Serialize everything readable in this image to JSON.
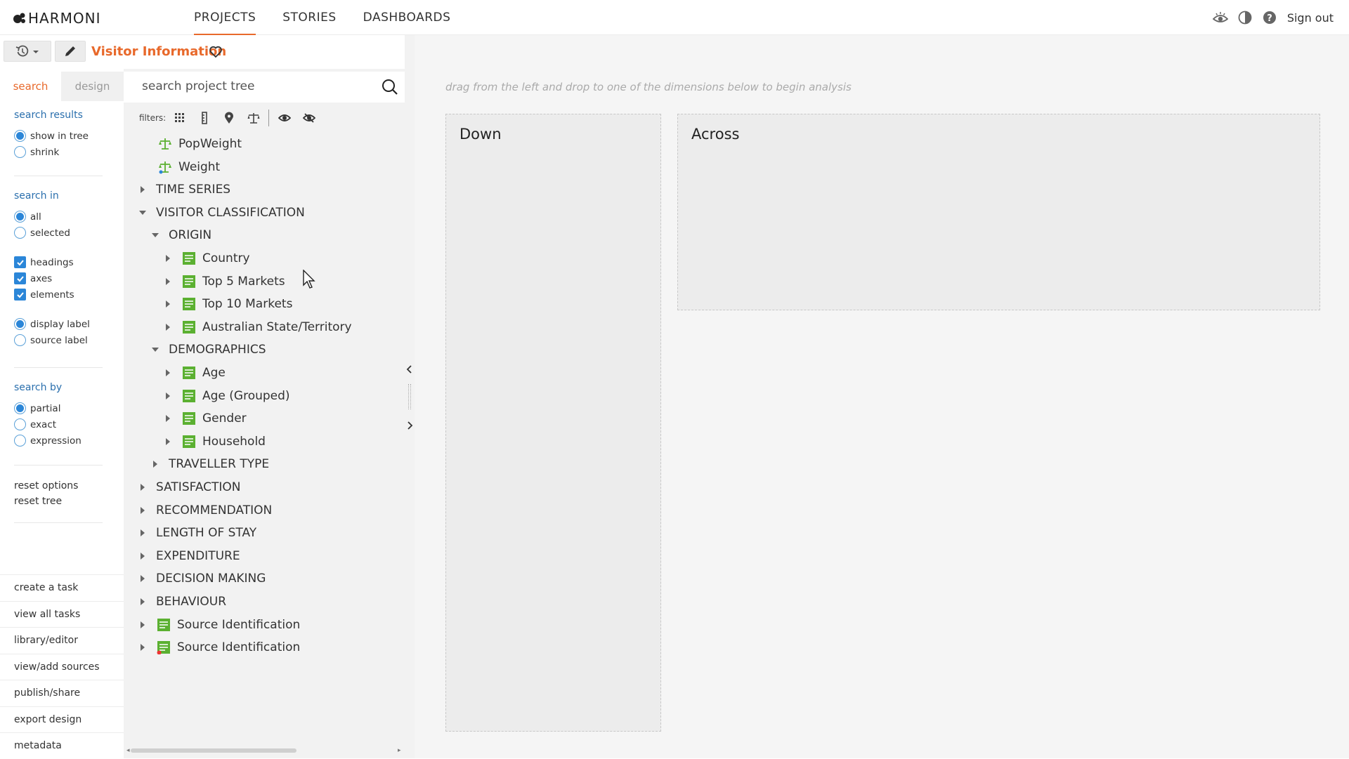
{
  "brand": {
    "name": "HARMONI"
  },
  "nav": {
    "items": [
      "PROJECTS",
      "STORIES",
      "DASHBOARDS"
    ],
    "active": "PROJECTS"
  },
  "top_right": {
    "icons": [
      "eye-icon",
      "contrast-icon",
      "help-icon"
    ],
    "sign_out": "Sign out"
  },
  "toolbar": {
    "title": "Visitor Information",
    "history_icon": "history-icon",
    "edit_icon": "pencil-icon",
    "favorite_icon": "heart-icon"
  },
  "left_tabs": {
    "search": "search",
    "design": "design"
  },
  "search_results": {
    "title": "search results",
    "options": [
      "show in tree",
      "shrink"
    ],
    "selected": "show in tree"
  },
  "search_in": {
    "title": "search in",
    "options": [
      "all",
      "selected"
    ],
    "selected": "all",
    "checks": [
      "headings",
      "axes",
      "elements"
    ],
    "label_options": [
      "display label",
      "source label"
    ],
    "label_selected": "display label"
  },
  "search_by": {
    "title": "search by",
    "options": [
      "partial",
      "exact",
      "expression"
    ],
    "selected": "partial"
  },
  "resets": [
    "reset options",
    "reset tree"
  ],
  "bottom_links": [
    "create a task",
    "view all tasks",
    "library/editor",
    "view/add sources",
    "publish/share",
    "export design",
    "metadata"
  ],
  "tree_search": {
    "placeholder": "search project tree"
  },
  "filters": {
    "label": "filters:"
  },
  "tree": [
    {
      "label": "PopWeight",
      "depth": 1,
      "type": "weight",
      "arrow": "none"
    },
    {
      "label": "Weight",
      "depth": 1,
      "type": "weight2",
      "arrow": "none"
    },
    {
      "label": "TIME SERIES",
      "depth": 0,
      "type": "folder",
      "arrow": "right"
    },
    {
      "label": "VISITOR CLASSIFICATION",
      "depth": 0,
      "type": "folder",
      "arrow": "down"
    },
    {
      "label": "ORIGIN",
      "depth": 1,
      "type": "folder",
      "arrow": "down"
    },
    {
      "label": "Country",
      "depth": 2,
      "type": "var",
      "arrow": "right"
    },
    {
      "label": "Top 5 Markets",
      "depth": 2,
      "type": "var",
      "arrow": "right"
    },
    {
      "label": "Top 10 Markets",
      "depth": 2,
      "type": "var",
      "arrow": "right"
    },
    {
      "label": "Australian State/Territory",
      "depth": 2,
      "type": "var",
      "arrow": "right"
    },
    {
      "label": "DEMOGRAPHICS",
      "depth": 1,
      "type": "folder",
      "arrow": "down"
    },
    {
      "label": "Age",
      "depth": 2,
      "type": "var",
      "arrow": "right"
    },
    {
      "label": "Age (Grouped)",
      "depth": 2,
      "type": "var",
      "arrow": "right"
    },
    {
      "label": "Gender",
      "depth": 2,
      "type": "var",
      "arrow": "right"
    },
    {
      "label": "Household",
      "depth": 2,
      "type": "var",
      "arrow": "right"
    },
    {
      "label": "TRAVELLER TYPE",
      "depth": 1,
      "type": "folder",
      "arrow": "right"
    },
    {
      "label": "SATISFACTION",
      "depth": 0,
      "type": "folder",
      "arrow": "right"
    },
    {
      "label": "RECOMMENDATION",
      "depth": 0,
      "type": "folder",
      "arrow": "right"
    },
    {
      "label": "LENGTH OF STAY",
      "depth": 0,
      "type": "folder",
      "arrow": "right"
    },
    {
      "label": "EXPENDITURE",
      "depth": 0,
      "type": "folder",
      "arrow": "right"
    },
    {
      "label": "DECISION MAKING",
      "depth": 0,
      "type": "folder",
      "arrow": "right"
    },
    {
      "label": "BEHAVIOUR",
      "depth": 0,
      "type": "folder",
      "arrow": "right"
    },
    {
      "label": "Source Identification",
      "depth": 0,
      "type": "var-top",
      "arrow": "right"
    },
    {
      "label": "Source Identification",
      "depth": 0,
      "type": "var-top-red",
      "arrow": "right"
    }
  ],
  "main": {
    "hint": "drag from the left and drop to one of the dimensions below to begin analysis",
    "down_label": "Down",
    "across_label": "Across"
  },
  "colors": {
    "accent": "#e8692b",
    "link_blue": "#2a6fad",
    "check_blue": "#2b86d8",
    "var_green": "#5bb031"
  }
}
